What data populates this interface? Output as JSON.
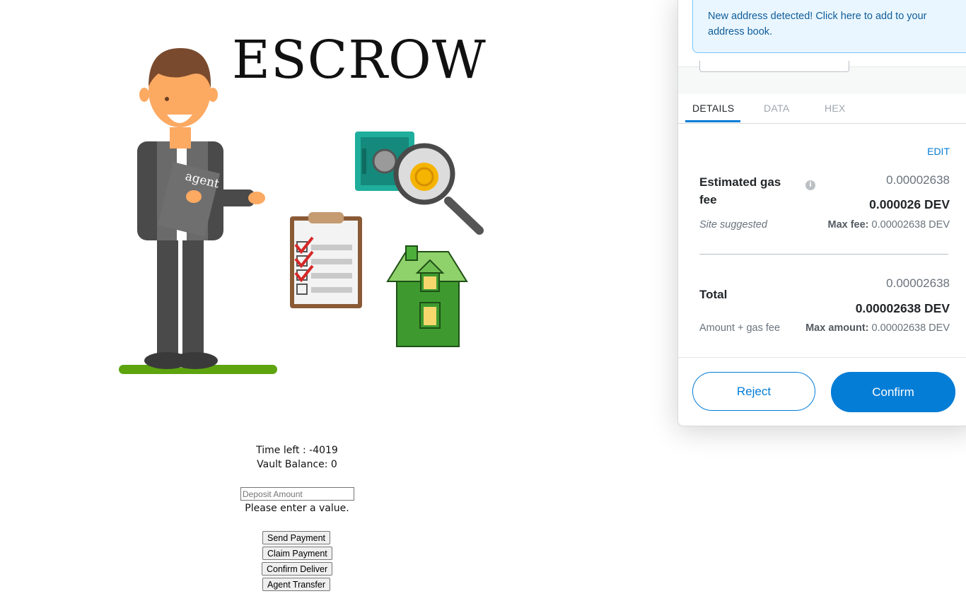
{
  "dapp": {
    "title": "ESCROW",
    "agent_doc_label": "agent",
    "time_left_text": "Time left : -4019",
    "vault_balance_text": "Vault Balance: 0",
    "deposit_placeholder": "Deposit Amount",
    "validation_message": "Please enter a value.",
    "buttons": [
      "Send Payment",
      "Claim Payment",
      "Confirm Deliver",
      "Agent Transfer"
    ]
  },
  "metamask": {
    "banner_text": "New address detected! Click here to add to your address book.",
    "tabs": [
      "DETAILS",
      "DATA",
      "HEX"
    ],
    "active_tab": "DETAILS",
    "edit_label": "EDIT",
    "gas": {
      "label": "Estimated gas fee",
      "value_muted": "0.00002638",
      "value_bold": "0.000026 DEV",
      "sublabel": "Site suggested",
      "max_label": "Max fee:",
      "max_value": "0.00002638 DEV"
    },
    "total": {
      "label": "Total",
      "value_muted": "0.00002638",
      "value_bold": "0.00002638 DEV",
      "sublabel": "Amount + gas fee",
      "max_label": "Max amount:",
      "max_value": "0.00002638 DEV"
    },
    "reject_label": "Reject",
    "confirm_label": "Confirm",
    "accent_color": "#037dd6"
  }
}
